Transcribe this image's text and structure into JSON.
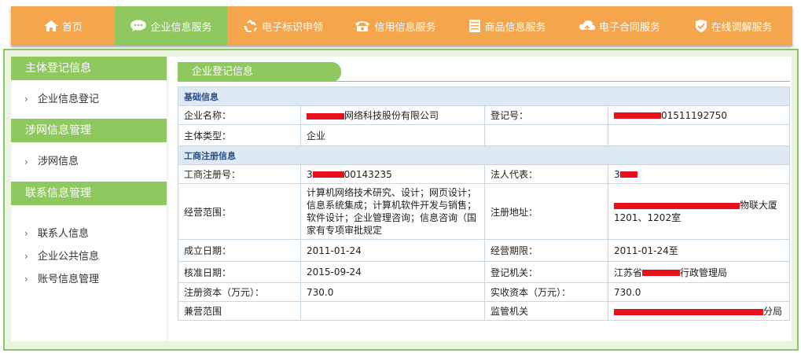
{
  "nav": {
    "items": [
      {
        "label": "首页",
        "icon": "home-icon"
      },
      {
        "label": "企业信息服务",
        "icon": "chat-bubble-icon",
        "active": true
      },
      {
        "label": "电子标识申领",
        "icon": "recycle-icon"
      },
      {
        "label": "信用信息服务",
        "icon": "phone-icon"
      },
      {
        "label": "商品信息服务",
        "icon": "list-icon"
      },
      {
        "label": "电子合同服务",
        "icon": "cloud-icon"
      },
      {
        "label": "在线调解服务",
        "icon": "shield-icon"
      }
    ]
  },
  "sidebar": {
    "sections": [
      {
        "title": "主体登记信息",
        "items": [
          "企业信息登记"
        ]
      },
      {
        "title": "涉网信息管理",
        "items": [
          "涉网信息"
        ]
      },
      {
        "title": "联系信息管理",
        "items": [
          "联系人信息",
          "企业公共信息",
          "账号信息管理"
        ]
      }
    ]
  },
  "main": {
    "tab": "企业登记信息",
    "basic": {
      "section_title": "基础信息",
      "company_name_label": "企业名称：",
      "company_name_value": "网络科技股份有限公司",
      "reg_no_label": "登记号：",
      "reg_no_value": "01511192750",
      "entity_type_label": "主体类型：",
      "entity_type_value": "企业"
    },
    "registration": {
      "section_title": "工商注册信息",
      "biz_reg_no_label": "工商注册号：",
      "biz_reg_no_prefix": "3",
      "biz_reg_no_value": "00143235",
      "legal_rep_label": "法人代表：",
      "legal_rep_prefix": "3",
      "scope_label": "经营范围：",
      "scope_value": "计算机网络技术研究、设计；网页设计；信息系统集成；计算机软件开发与销售；软件设计；企业管理咨询；信息咨询（国家有专项审批规定",
      "address_label": "注册地址：",
      "address_line1": "物联大厦",
      "address_line2": "1201、1202室",
      "established_label": "成立日期：",
      "established_value": "2011-01-24",
      "term_label": "经营期限：",
      "term_value": "2011-01-24至",
      "approved_label": "核准日期：",
      "approved_value": "2015-09-24",
      "authority_label": "登记机关：",
      "authority_prefix": "江苏省",
      "authority_suffix": "行政管理局",
      "capital_label": "注册资本（万元）：",
      "capital_value": "730.0",
      "paid_capital_label": "实收资本（万元）：",
      "paid_capital_value": "730.0",
      "secondary_scope_label": "兼营范围",
      "secondary_scope_value": "",
      "supervisor_label": "监管机关",
      "supervisor_suffix": "分局"
    }
  },
  "colors": {
    "nav_bg": "#f5a54c",
    "green": "#8ec85e",
    "section_bg": "#dde9f4",
    "section_text": "#2a4f84",
    "redaction": "#e8101a"
  }
}
